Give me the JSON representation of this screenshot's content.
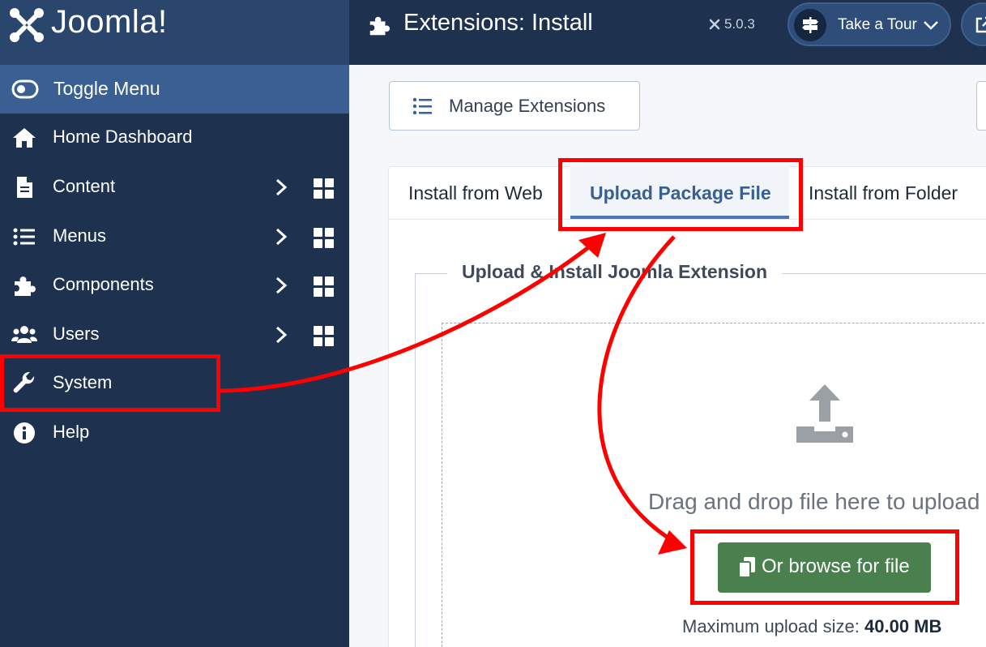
{
  "brand": {
    "name": "Joomla!"
  },
  "sidebar": {
    "toggle_label": "Toggle Menu",
    "items": [
      {
        "label": "Home Dashboard",
        "icon": "home-icon"
      },
      {
        "label": "Content",
        "icon": "file-icon"
      },
      {
        "label": "Menus",
        "icon": "list-icon"
      },
      {
        "label": "Components",
        "icon": "puzzle-icon"
      },
      {
        "label": "Users",
        "icon": "users-icon"
      },
      {
        "label": "System",
        "icon": "wrench-icon"
      },
      {
        "label": "Help",
        "icon": "info-icon"
      }
    ]
  },
  "header": {
    "title": "Extensions: Install",
    "version": "5.0.3",
    "tour_label": "Take a Tour"
  },
  "toolbar": {
    "manage_label": "Manage Extensions"
  },
  "tabs": [
    {
      "label": "Install from Web"
    },
    {
      "label": "Upload Package File"
    },
    {
      "label": "Install from Folder"
    }
  ],
  "upload": {
    "legend": "Upload & Install Joomla Extension",
    "drag_text": "Drag and drop file here to upload",
    "browse_label": "Or browse for file",
    "max_label": "Maximum upload size:",
    "max_value": "40.00 MB"
  },
  "colors": {
    "sidebar_bg": "#1e3250",
    "accent": "#3a6093",
    "browse_green": "#4a7f4e",
    "annotation_red": "#ff0000"
  }
}
